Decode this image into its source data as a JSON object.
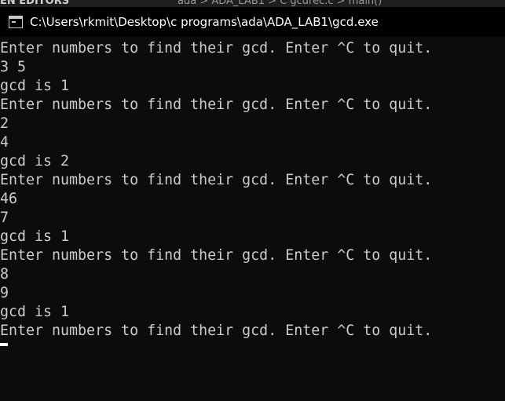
{
  "background_strip": {
    "left_text": "EN EDITORS",
    "right_text": "ada  >  ADA_LAB1  >  C  gcdrec.c  >  main()"
  },
  "window": {
    "title": "C:\\Users\\rkmit\\Desktop\\c programs\\ada\\ADA_LAB1\\gcd.exe",
    "icon": "console-window-icon"
  },
  "console": {
    "lines": [
      "Enter numbers to find their gcd. Enter ^C to quit.",
      "3 5",
      "gcd is 1",
      "Enter numbers to find their gcd. Enter ^C to quit.",
      "2",
      "4",
      "gcd is 2",
      "Enter numbers to find their gcd. Enter ^C to quit.",
      "46",
      "7",
      "gcd is 1",
      "Enter numbers to find their gcd. Enter ^C to quit.",
      "8",
      "9",
      "gcd is 1",
      "Enter numbers to find their gcd. Enter ^C to quit."
    ]
  },
  "colors": {
    "console_background": "#0c0c0c",
    "console_text": "#cccccc",
    "titlebar_background": "#000000",
    "title_text": "#ffffff",
    "cursor": "#ffffff"
  }
}
